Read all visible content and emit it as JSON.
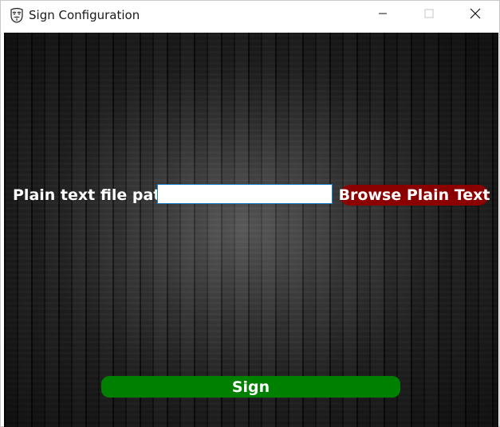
{
  "window": {
    "title": "Sign Configuration",
    "icon": "anonymous-mask-icon",
    "controls": {
      "minimize_icon": "minimize-icon",
      "maximize_icon": "maximize-icon",
      "close_icon": "close-icon"
    }
  },
  "form": {
    "path_label": "Plain text file path",
    "path_value": "",
    "browse_label": "Browse Plain Text",
    "sign_label": "Sign"
  },
  "colors": {
    "browse_button": "#8b0000",
    "sign_button": "#008000",
    "input_border": "#1a7fc9",
    "background": "#1e1e1e"
  }
}
